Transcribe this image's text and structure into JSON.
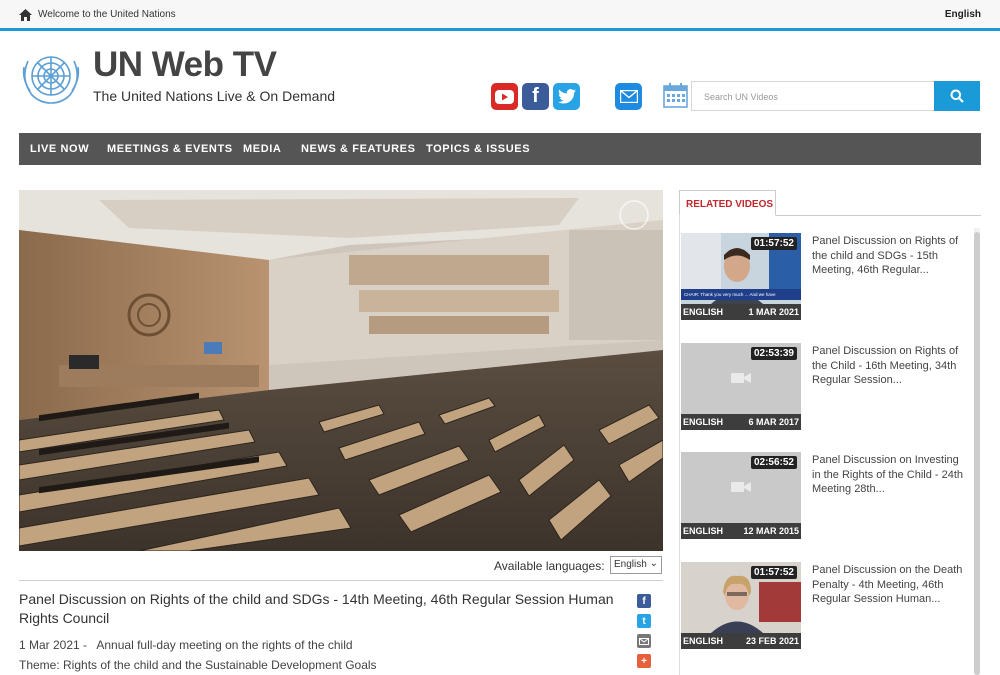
{
  "topbar": {
    "welcome": "Welcome to the United Nations",
    "language": "English"
  },
  "header": {
    "title": "UN Web TV",
    "subtitle": "The United Nations Live & On Demand"
  },
  "search": {
    "placeholder": "Search UN Videos"
  },
  "nav": {
    "items": [
      "LIVE NOW",
      "MEETINGS & EVENTS",
      "MEDIA",
      "NEWS & FEATURES",
      "TOPICS & ISSUES"
    ]
  },
  "video": {
    "available_languages_label": "Available languages:",
    "selected_language": "English",
    "title": "Panel Discussion on Rights of the child and SDGs - 14th Meeting, 46th Regular Session Human Rights Council",
    "date": "1 Mar 2021",
    "description": "Annual full-day meeting on the rights of the child",
    "theme": "Theme: Rights of the child and the Sustainable Development Goals"
  },
  "related": {
    "tab_label": "RELATED VIDEOS",
    "items": [
      {
        "duration": "01:57:52",
        "language": "ENGLISH",
        "date": "1 MAR 2021",
        "title": "Panel Discussion on Rights of the child and SDGs - 15th Meeting, 46th Regular..."
      },
      {
        "duration": "02:53:39",
        "language": "ENGLISH",
        "date": "6 MAR 2017",
        "title": "Panel Discussion on Rights of the Child - 16th Meeting, 34th Regular Session..."
      },
      {
        "duration": "02:56:52",
        "language": "ENGLISH",
        "date": "12 MAR 2015",
        "title": "Panel Discussion on Investing in the Rights of the Child - 24th Meeting 28th..."
      },
      {
        "duration": "01:57:52",
        "language": "ENGLISH",
        "date": "23 FEB 2021",
        "title": "Panel Discussion on the Death Penalty - 4th Meeting, 46th Regular Session Human..."
      }
    ]
  },
  "colors": {
    "accent": "#1a9bd7",
    "nav_bg": "#555555",
    "related_tab": "#c2272d"
  }
}
